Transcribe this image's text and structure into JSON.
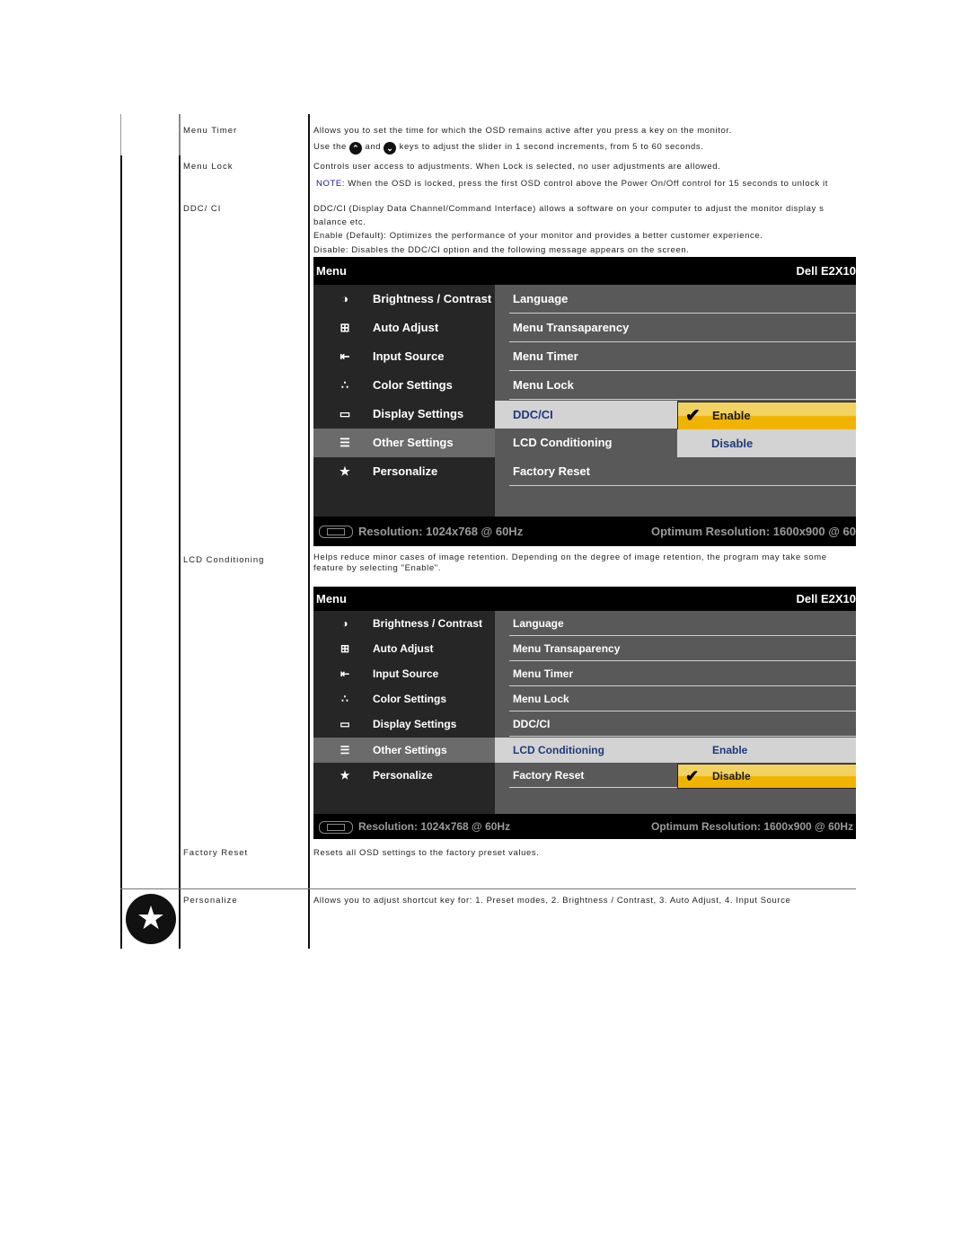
{
  "rows": {
    "menu_timer": {
      "label": "Menu Timer",
      "line1": "Allows you to set the time for which the OSD remains active after you press a key on the monitor.",
      "line2_pre": "Use the",
      "line2_mid": "and",
      "line2_post": "keys to adjust the slider in 1 second increments, from 5 to 60 seconds.",
      "up_key_icon": "up-chevron-key",
      "down_key_icon": "down-chevron-key"
    },
    "menu_lock": {
      "label": "Menu Lock",
      "line1": "Controls user access to adjustments. When Lock is selected, no user adjustments are allowed.",
      "note_label": "NOTE:",
      "note_text": " When the OSD is locked, press the first OSD control above the Power On/Off control for 15 seconds to unlock it"
    },
    "ddc_ci": {
      "label": "DDC/ CI",
      "line1": "DDC/CI (Display Data Channel/Command Interface) allows a software on your computer to adjust the monitor display s",
      "line2": "balance etc.",
      "line3": "Enable (Default): Optimizes the performance of your monitor and provides a better customer experience.",
      "line4": "Disable: Disables the DDC/CI option and the following message appears on the screen."
    },
    "lcd_conditioning": {
      "label": "LCD Conditioning",
      "line1": "Helps reduce minor cases of image retention. Depending on the degree of image retention, the program may take some",
      "line2": "feature by selecting \"Enable\"."
    },
    "factory_reset": {
      "label": "Factory Reset",
      "line1": "Resets all OSD settings to the factory preset values."
    },
    "personalize": {
      "label": "Personalize",
      "line1": "Allows you to adjust shortcut key for: 1. Preset modes, 2. Brightness / Contrast, 3. Auto Adjust, 4. Input Source",
      "icon": "star-circle-icon"
    }
  },
  "osd": {
    "title": "Menu",
    "model": "Dell E2X10",
    "main_items": [
      {
        "label": "Brightness / Contrast",
        "icon": "brightness-icon"
      },
      {
        "label": "Auto Adjust",
        "icon": "auto-adjust-icon"
      },
      {
        "label": "Input Source",
        "icon": "input-source-icon"
      },
      {
        "label": "Color Settings",
        "icon": "color-settings-icon"
      },
      {
        "label": "Display Settings",
        "icon": "display-settings-icon"
      },
      {
        "label": "Other Settings",
        "icon": "other-settings-icon",
        "selected": true
      },
      {
        "label": "Personalize",
        "icon": "star-icon"
      }
    ],
    "sub_items": [
      "Language",
      "Menu Transaparency",
      "Menu Timer",
      "Menu Lock",
      "DDC/CI",
      "LCD Conditioning",
      "Factory Reset"
    ],
    "resolution": "Resolution: 1024x768 @ 60Hz",
    "optimum": "Optimum Resolution: 1600x900 @ 60Hz",
    "screen1": {
      "highlighted_sub": "DDC/CI",
      "options": [
        {
          "label": "Enable",
          "checked": true
        },
        {
          "label": "Disable",
          "checked": false
        }
      ]
    },
    "screen2": {
      "highlighted_sub": "LCD Conditioning",
      "options": [
        {
          "label": "Enable",
          "checked": false
        },
        {
          "label": "Disable",
          "checked": true
        }
      ]
    }
  }
}
